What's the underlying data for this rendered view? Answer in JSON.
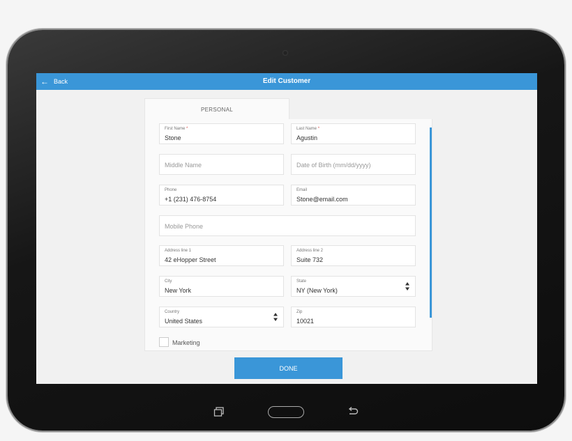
{
  "topbar": {
    "back_label": "Back",
    "title": "Edit Customer"
  },
  "tabs": [
    {
      "label": "PERSONAL"
    }
  ],
  "form": {
    "first_name": {
      "label": "First Name",
      "required": "*",
      "value": "Stone"
    },
    "last_name": {
      "label": "Last Name",
      "required": "*",
      "value": "Agustin"
    },
    "middle_name": {
      "placeholder": "Middle Name"
    },
    "date_of_birth": {
      "placeholder": "Date of Birth (mm/dd/yyyy)"
    },
    "phone": {
      "label": "Phone",
      "value": "+1 (231) 476-8754"
    },
    "email": {
      "label": "Email",
      "value": "Stone@email.com"
    },
    "mobile_phone": {
      "placeholder": "Mobile Phone"
    },
    "address_line_1": {
      "label": "Address line 1",
      "value": "42 eHopper Street"
    },
    "address_line_2": {
      "label": "Address line 2",
      "value": "Suite 732"
    },
    "city": {
      "label": "City",
      "value": "New York"
    },
    "state": {
      "label": "State",
      "value": "NY (New York)"
    },
    "country": {
      "label": "Country",
      "value": "United States"
    },
    "zip": {
      "label": "Zip",
      "value": "10021"
    },
    "marketing": {
      "label": "Marketing",
      "checked": false
    }
  },
  "done_label": "DONE",
  "colors": {
    "accent": "#3a96d8",
    "required": "#d9534f"
  }
}
